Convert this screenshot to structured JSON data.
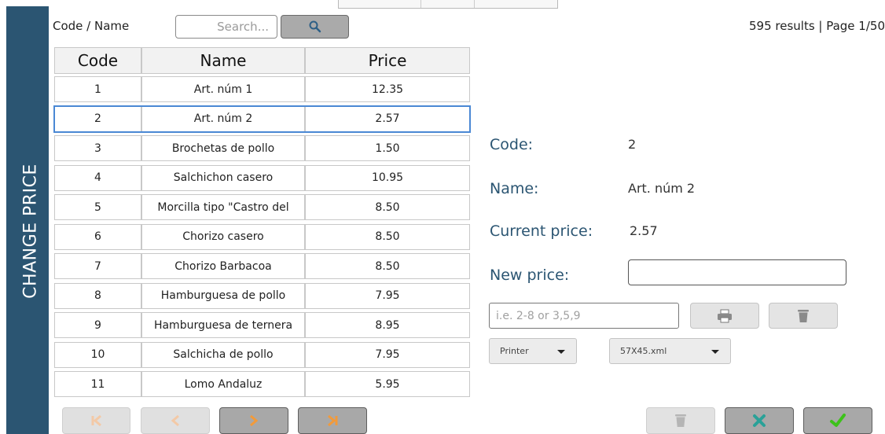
{
  "sidebar": {
    "title": "CHANGE PRICE"
  },
  "search": {
    "label": "Code / Name",
    "placeholder": "Search...",
    "button_icon": "search-icon",
    "results_text": "595 results | Page 1/50"
  },
  "table": {
    "headers": [
      "Code",
      "Name",
      "Price"
    ],
    "rows": [
      {
        "code": "1",
        "name": "Art. núm 1",
        "price": "12.35"
      },
      {
        "code": "2",
        "name": "Art. núm 2",
        "price": "2.57"
      },
      {
        "code": "3",
        "name": "Brochetas de pollo",
        "price": "1.50"
      },
      {
        "code": "4",
        "name": "Salchichon casero",
        "price": "10.95"
      },
      {
        "code": "5",
        "name": "Morcilla tipo \"Castro del",
        "price": "8.50"
      },
      {
        "code": "6",
        "name": "Chorizo casero",
        "price": "8.50"
      },
      {
        "code": "7",
        "name": "Chorizo Barbacoa",
        "price": "8.50"
      },
      {
        "code": "8",
        "name": "Hamburguesa de pollo",
        "price": "7.95"
      },
      {
        "code": "9",
        "name": "Hamburguesa de ternera",
        "price": "8.95"
      },
      {
        "code": "10",
        "name": "Salchicha de pollo",
        "price": "7.95"
      },
      {
        "code": "11",
        "name": "Lomo Andaluz",
        "price": "5.95"
      }
    ],
    "selected_code": "2"
  },
  "detail": {
    "code_label": "Code:",
    "code_value": "2",
    "name_label": "Name:",
    "name_value": "Art. núm 2",
    "current_price_label": "Current price:",
    "current_price_value": "2.57",
    "new_price_label": "New price:",
    "new_price_value": ""
  },
  "print": {
    "range_placeholder": "i.e. 2-8 or 3,5,9",
    "printer_selected": "Printer",
    "template_selected": "57X45.xml"
  },
  "colors": {
    "sidebar": "#2b5572",
    "label": "#2b5572",
    "nav_arrow": "#f29a3a",
    "cancel": "#2aa198",
    "confirm": "#3cc21a",
    "selection": "#4a88d4"
  }
}
